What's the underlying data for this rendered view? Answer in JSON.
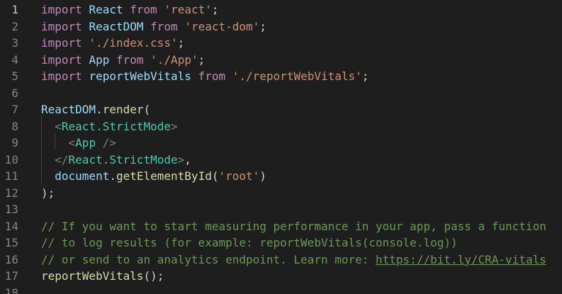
{
  "editor": {
    "line_numbers": [
      "1",
      "2",
      "3",
      "4",
      "5",
      "6",
      "7",
      "8",
      "9",
      "10",
      "11",
      "12",
      "13",
      "14",
      "15",
      "16",
      "17",
      "18"
    ],
    "active_line": "1",
    "colors": {
      "background": "#1e1e1e",
      "keyword": "#c586c0",
      "variable": "#9cdcfe",
      "string": "#ce9178",
      "function": "#dcdcaa",
      "jsx_tag": "#4ec9b0",
      "comment": "#6a9955",
      "line_number": "#858585"
    },
    "lines": [
      {
        "tokens": [
          {
            "t": "import",
            "c": "kw"
          },
          {
            "t": " ",
            "c": "plain"
          },
          {
            "t": "React",
            "c": "var"
          },
          {
            "t": " ",
            "c": "plain"
          },
          {
            "t": "from",
            "c": "kw"
          },
          {
            "t": " ",
            "c": "plain"
          },
          {
            "t": "'react'",
            "c": "str"
          },
          {
            "t": ";",
            "c": "plain"
          }
        ]
      },
      {
        "tokens": [
          {
            "t": "import",
            "c": "kw"
          },
          {
            "t": " ",
            "c": "plain"
          },
          {
            "t": "ReactDOM",
            "c": "var"
          },
          {
            "t": " ",
            "c": "plain"
          },
          {
            "t": "from",
            "c": "kw"
          },
          {
            "t": " ",
            "c": "plain"
          },
          {
            "t": "'react-dom'",
            "c": "str"
          },
          {
            "t": ";",
            "c": "plain"
          }
        ]
      },
      {
        "tokens": [
          {
            "t": "import",
            "c": "kw"
          },
          {
            "t": " ",
            "c": "plain"
          },
          {
            "t": "'./index.css'",
            "c": "str"
          },
          {
            "t": ";",
            "c": "plain"
          }
        ]
      },
      {
        "tokens": [
          {
            "t": "import",
            "c": "kw"
          },
          {
            "t": " ",
            "c": "plain"
          },
          {
            "t": "App",
            "c": "var"
          },
          {
            "t": " ",
            "c": "plain"
          },
          {
            "t": "from",
            "c": "kw"
          },
          {
            "t": " ",
            "c": "plain"
          },
          {
            "t": "'./App'",
            "c": "str"
          },
          {
            "t": ";",
            "c": "plain"
          }
        ]
      },
      {
        "tokens": [
          {
            "t": "import",
            "c": "kw"
          },
          {
            "t": " ",
            "c": "plain"
          },
          {
            "t": "reportWebVitals",
            "c": "var"
          },
          {
            "t": " ",
            "c": "plain"
          },
          {
            "t": "from",
            "c": "kw"
          },
          {
            "t": " ",
            "c": "plain"
          },
          {
            "t": "'./reportWebVitals'",
            "c": "str"
          },
          {
            "t": ";",
            "c": "plain"
          }
        ]
      },
      {
        "tokens": []
      },
      {
        "tokens": [
          {
            "t": "ReactDOM",
            "c": "var"
          },
          {
            "t": ".",
            "c": "plain"
          },
          {
            "t": "render",
            "c": "fn"
          },
          {
            "t": "(",
            "c": "plain"
          }
        ]
      },
      {
        "tokens": [
          {
            "t": "  ",
            "c": "plain"
          },
          {
            "t": "<",
            "c": "pun"
          },
          {
            "t": "React.StrictMode",
            "c": "tag"
          },
          {
            "t": ">",
            "c": "pun"
          }
        ]
      },
      {
        "tokens": [
          {
            "t": "    ",
            "c": "plain"
          },
          {
            "t": "<",
            "c": "pun"
          },
          {
            "t": "App",
            "c": "tag"
          },
          {
            "t": " />",
            "c": "pun"
          }
        ]
      },
      {
        "tokens": [
          {
            "t": "  ",
            "c": "plain"
          },
          {
            "t": "</",
            "c": "pun"
          },
          {
            "t": "React.StrictMode",
            "c": "tag"
          },
          {
            "t": ">",
            "c": "pun"
          },
          {
            "t": ",",
            "c": "plain"
          }
        ]
      },
      {
        "tokens": [
          {
            "t": "  ",
            "c": "plain"
          },
          {
            "t": "document",
            "c": "var"
          },
          {
            "t": ".",
            "c": "plain"
          },
          {
            "t": "getElementById",
            "c": "fn"
          },
          {
            "t": "(",
            "c": "plain"
          },
          {
            "t": "'root'",
            "c": "str"
          },
          {
            "t": ")",
            "c": "plain"
          }
        ]
      },
      {
        "tokens": [
          {
            "t": ");",
            "c": "plain"
          }
        ]
      },
      {
        "tokens": []
      },
      {
        "tokens": [
          {
            "t": "// If you want to start measuring performance in your app, pass a function",
            "c": "cmt"
          }
        ]
      },
      {
        "tokens": [
          {
            "t": "// to log results (for example: reportWebVitals(console.log))",
            "c": "cmt"
          }
        ]
      },
      {
        "tokens": [
          {
            "t": "// or send to an analytics endpoint. Learn more: ",
            "c": "cmt"
          },
          {
            "t": "https://bit.ly/CRA-vitals",
            "c": "lnk"
          }
        ]
      },
      {
        "tokens": [
          {
            "t": "reportWebVitals",
            "c": "fn"
          },
          {
            "t": "();",
            "c": "plain"
          }
        ]
      },
      {
        "tokens": []
      }
    ]
  }
}
